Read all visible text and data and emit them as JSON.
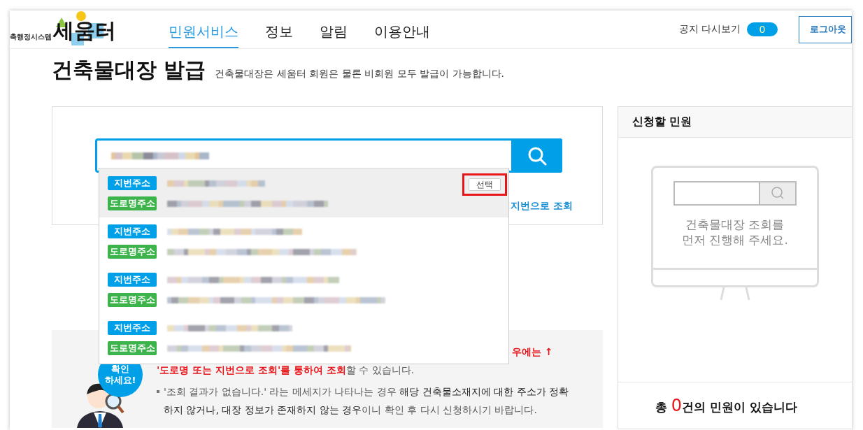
{
  "header": {
    "logo_caption": "축행정시스템",
    "logo_text": "세움터",
    "nav": [
      {
        "label": "민원서비스",
        "selected": true
      },
      {
        "label": "정보",
        "selected": false
      },
      {
        "label": "알림",
        "selected": false
      },
      {
        "label": "이용안내",
        "selected": false
      }
    ],
    "notice_label": "공지 다시보기",
    "notice_count": "0",
    "logout": "로그아웃"
  },
  "page": {
    "title": "건축물대장 발급",
    "subtitle": "건축물대장은 세움터 회원은 물론 비회원 모두 발급이 가능합니다."
  },
  "search": {
    "link": "지번으로 조회"
  },
  "suggestions": [
    {
      "jibun_label": "지번주소",
      "road_label": "도로명주소",
      "selected": true,
      "select_button": "선택"
    },
    {
      "jibun_label": "지번주소",
      "road_label": "도로명주소",
      "selected": false
    },
    {
      "jibun_label": "지번주소",
      "road_label": "도로명주소",
      "selected": false
    },
    {
      "jibun_label": "지번주소",
      "road_label": "도로명주소",
      "selected": false
    }
  ],
  "notice": {
    "badge": "확인 하세요!",
    "partial_line": "우에는 ↑",
    "line_2": "**'도로명 또는 지번으로 조회'를 통하여 조회**할 수 있습니다.",
    "bullet": "'조회 결과가 없습니다.' 라는 메세지가 나타나는 경우 **해당 건축물소재지에 대한 주소가 정확하지 않거나, 대장 정보가 존재하지 않는 경우**이니 확인 후 다시 신청하시기 바랍니다."
  },
  "side_panel": {
    "title": "신청할 민원",
    "empty_message": "건축물대장 조회를 먼저 진행해 주세요.",
    "total": "총 **0**건의 민원이 있습니다"
  }
}
